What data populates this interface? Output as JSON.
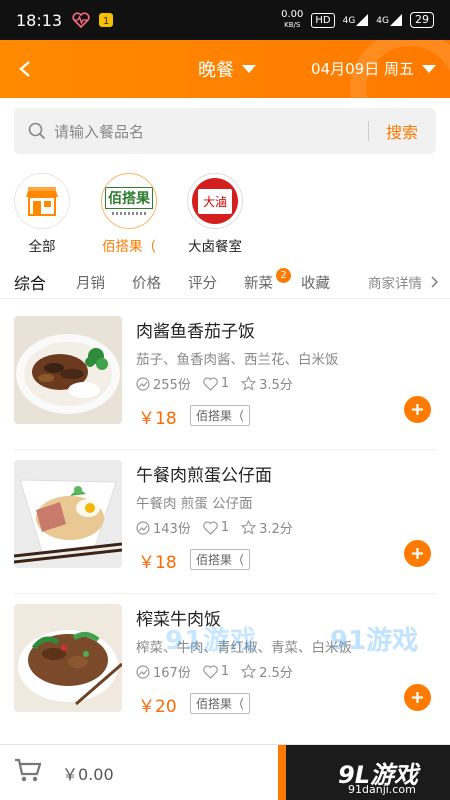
{
  "status_bar": {
    "time": "18:13",
    "net_speed_value": "0.00",
    "net_speed_unit": "KB/S",
    "hd_badge": "HD",
    "signal1": "4G",
    "signal2": "4G",
    "battery": "29"
  },
  "header": {
    "meal": "晚餐",
    "date": "04月09日 周五"
  },
  "search": {
    "placeholder": "请输入餐品名",
    "button": "搜索"
  },
  "shops": [
    {
      "label": "全部",
      "active": false
    },
    {
      "label": "佰搭果（",
      "logo_text": "佰搭果",
      "active": true
    },
    {
      "label": "大卤餐室",
      "logo_text": "大滷",
      "active": false
    }
  ],
  "tabs": {
    "items": [
      "综合",
      "月销",
      "价格",
      "评分",
      "新菜",
      "收藏"
    ],
    "new_count": "2",
    "merchant_detail": "商家详情"
  },
  "items": [
    {
      "name": "肉酱鱼香茄子饭",
      "desc": "茄子、鱼香肉酱、西兰花、白米饭",
      "sales": "255份",
      "likes": "1",
      "rating": "3.5分",
      "price": "￥18",
      "shop_tag": "佰搭果（"
    },
    {
      "name": "午餐肉煎蛋公仔面",
      "desc": "午餐肉 煎蛋 公仔面",
      "sales": "143份",
      "likes": "1",
      "rating": "3.2分",
      "price": "￥18",
      "shop_tag": "佰搭果（"
    },
    {
      "name": "榨菜牛肉饭",
      "desc": "榨菜、牛肉、青红椒、青菜、白米饭",
      "sales": "167份",
      "likes": "1",
      "rating": "2.5分",
      "price": "￥20",
      "shop_tag": "佰搭果（"
    }
  ],
  "watermark": {
    "text1": "91游戏",
    "text2": "91游戏"
  },
  "bottom": {
    "cart_total": "￥0.00",
    "logo": "9L游戏",
    "logo_sub": "91danji.com"
  },
  "colors": {
    "accent": "#ff7a00",
    "price": "#ff6a00"
  }
}
